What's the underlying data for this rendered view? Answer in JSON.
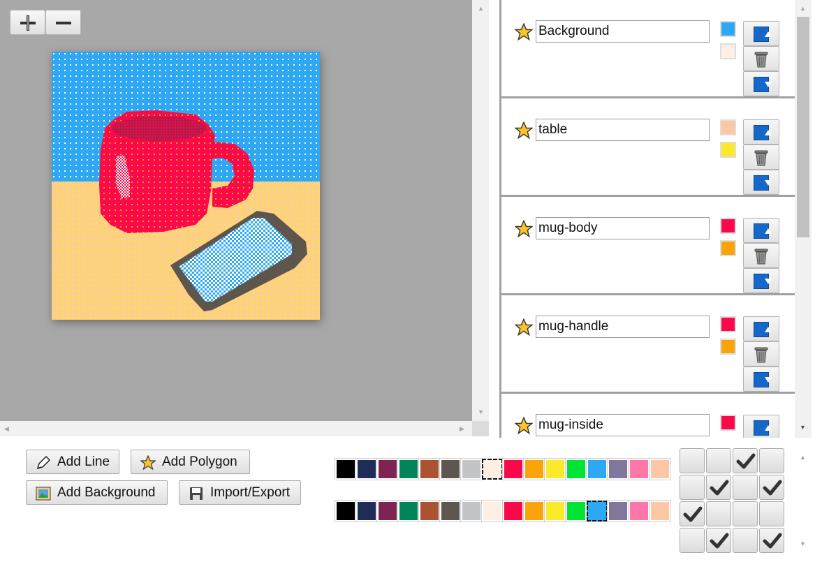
{
  "canvas": {
    "zoom_in_label": "+",
    "zoom_out_label": "−",
    "scroll_arrows": {
      "up": "▲",
      "down": "▼",
      "left": "◀",
      "right": "▶"
    },
    "art_colors": {
      "sky": "#2ea8f2",
      "table": "#fdd183",
      "mug": "#fa0a4b",
      "mug_inside": "#b41a4a",
      "phone_frame": "#5e554d",
      "phone_screen": "#2ea8f2",
      "highlight": "#ffffff",
      "dot": "#fcd22a"
    }
  },
  "layers": [
    {
      "name": "Background",
      "fg": "#2ea8f2",
      "bg": "#fdefe4"
    },
    {
      "name": "table",
      "fg": "#fcc7a4",
      "bg": "#fbe92b"
    },
    {
      "name": "mug-body",
      "fg": "#fa0a4b",
      "bg": "#fba30a"
    },
    {
      "name": "mug-handle",
      "fg": "#fa0a4b",
      "bg": "#fba30a"
    },
    {
      "name": "mug-inside",
      "fg": "#fa0a4b",
      "bg": ""
    }
  ],
  "toolbar": {
    "add_line": "Add Line",
    "add_polygon": "Add Polygon",
    "add_background": "Add Background",
    "import_export": "Import/Export"
  },
  "palette_colors": [
    "#000000",
    "#1f2c58",
    "#7e2453",
    "#00845a",
    "#ab5232",
    "#5e574f",
    "#c3c4c6",
    "#fdefe4",
    "#fa0a4b",
    "#fba30a",
    "#fbe92b",
    "#00e436",
    "#2ea8f2",
    "#83769c",
    "#ff77a8",
    "#fcc7a4"
  ],
  "palette_top_selected": 7,
  "palette_bottom_selected": 12,
  "pattern_grid": [
    [
      false,
      false,
      true,
      false
    ],
    [
      false,
      true,
      false,
      true
    ],
    [
      true,
      false,
      false,
      false
    ],
    [
      false,
      true,
      false,
      true
    ]
  ]
}
